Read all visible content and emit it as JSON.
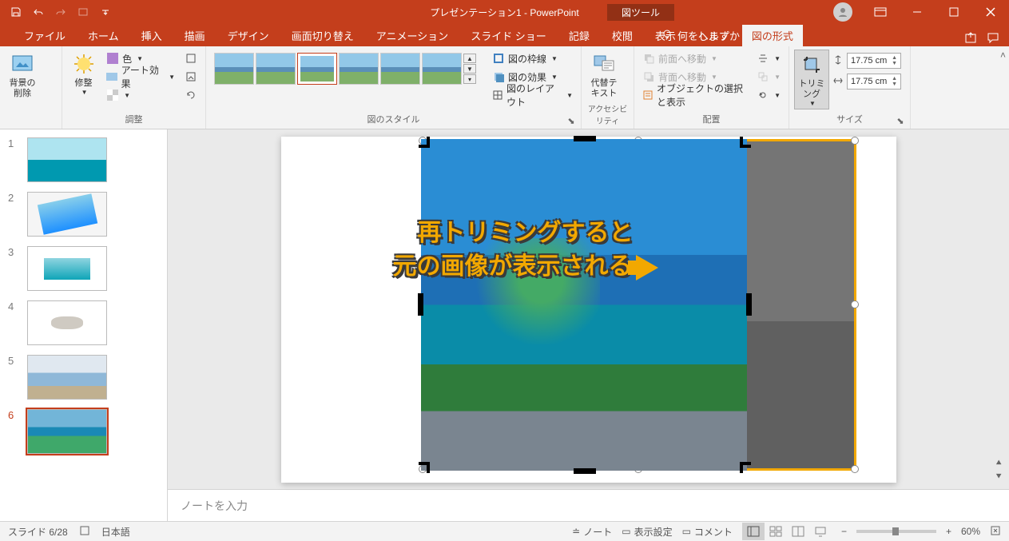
{
  "title": "プレゼンテーション1 - PowerPoint",
  "contextual_tab": "図ツール",
  "tabs": [
    "ファイル",
    "ホーム",
    "挿入",
    "描画",
    "デザイン",
    "画面切り替え",
    "アニメーション",
    "スライド ショー",
    "記録",
    "校閲",
    "表示",
    "ヘルプ",
    "図の形式"
  ],
  "active_tab_index": 12,
  "tell_me": "何をしますか",
  "ribbon": {
    "remove_bg": "背景の\n削除",
    "corrections": "修整",
    "color": "色",
    "artistic": "アート効果",
    "adjust_label": "調整",
    "styles_label": "図のスタイル",
    "border": "図の枠線",
    "effects": "図の効果",
    "layout": "図のレイアウト",
    "alt_text": "代替テ\nキスト",
    "accessibility_label": "アクセシビリティ",
    "bring_forward": "前面へ移動",
    "send_backward": "背面へ移動",
    "selection_pane": "オブジェクトの選択と表示",
    "arrange_label": "配置",
    "crop": "トリミング",
    "size_label": "サイズ",
    "height": "17.75 cm",
    "width": "17.75 cm"
  },
  "slides": [
    {
      "num": "1"
    },
    {
      "num": "2"
    },
    {
      "num": "3"
    },
    {
      "num": "4"
    },
    {
      "num": "5"
    },
    {
      "num": "6"
    }
  ],
  "current_slide": 6,
  "annotation_line1": "再トリミングすると",
  "annotation_line2": "元の画像が表示される",
  "notes_placeholder": "ノートを入力",
  "status": {
    "slide": "スライド 6/28",
    "lang": "日本語",
    "notes_btn": "ノート",
    "display_settings": "表示設定",
    "comments": "コメント",
    "zoom": "60%"
  }
}
